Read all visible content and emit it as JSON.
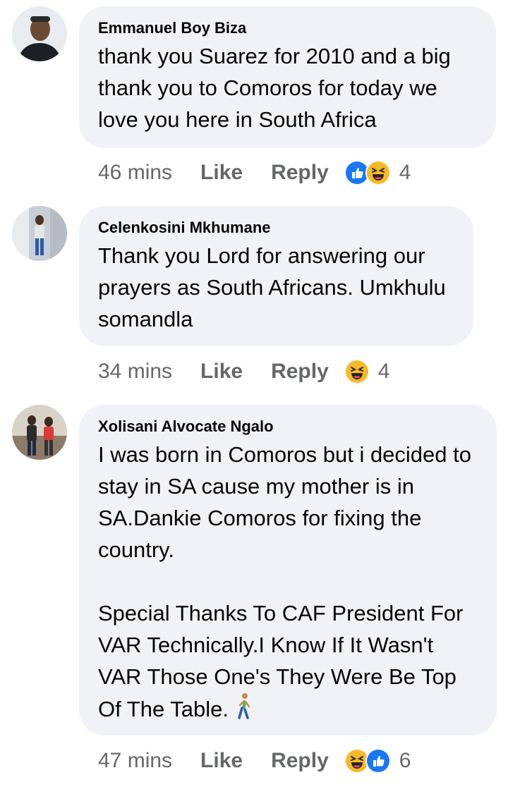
{
  "comments": [
    {
      "author": "Emmanuel Boy Biza",
      "text": "thank you Suarez for 2010 and a big thank you to Comoros for today we love you here in South Africa",
      "time": "46 mins",
      "like_label": "Like",
      "reply_label": "Reply",
      "reactions": [
        "like",
        "haha"
      ],
      "reaction_count": "4"
    },
    {
      "author": "Celenkosini Mkhumane",
      "text": "Thank you Lord for answering our prayers as South Africans. Umkhulu somandla",
      "time": "34 mins",
      "like_label": "Like",
      "reply_label": "Reply",
      "reactions": [
        "haha"
      ],
      "reaction_count": "4"
    },
    {
      "author": "Xolisani Alvocate Ngalo",
      "text_paragraph_1": "I was born in Comoros but i decided to stay in SA cause my mother is in SA.Dankie Comoros for fixing the country.",
      "text_paragraph_2": "Special Thanks To CAF President For VAR Technically.I Know If It Wasn't VAR Those One's They Were Be Top Of The Table.",
      "trailing_emoji": "person-walking-icon",
      "time": "47 mins",
      "like_label": "Like",
      "reply_label": "Reply",
      "reactions": [
        "haha",
        "like"
      ],
      "reaction_count": "6"
    }
  ],
  "colors": {
    "bubble": "#f0f2f5",
    "meta_text": "#65676b",
    "like_blue": "#1877f2",
    "haha_yellow": "#f7b928"
  }
}
